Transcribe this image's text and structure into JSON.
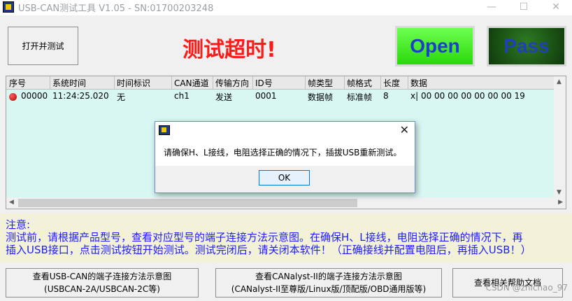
{
  "window": {
    "title": "USB-CAN测试工具 V1.05 - SN:01700203248",
    "minimize": "—",
    "maximize": "☐",
    "close": "✕"
  },
  "toolbar": {
    "start_label": "打开并测试",
    "timeout_text": "测试超时!",
    "open_label": "Open",
    "pass_label": "Pass"
  },
  "grid": {
    "columns": [
      "序号",
      "系统时间",
      "时间标识",
      "CAN通道",
      "传输方向",
      "ID号",
      "帧类型",
      "帧格式",
      "长度",
      "数据"
    ],
    "rows": [
      {
        "index": "00000",
        "time": "11:24:25.020",
        "timestamp": "无",
        "channel": "ch1",
        "direction": "发送",
        "id": "0001",
        "frame_type": "数据帧",
        "frame_format": "标准帧",
        "length": "8",
        "data": "x| 00 00 00 00 00 00 00 19"
      }
    ]
  },
  "notes": {
    "heading": "注意:",
    "line1": "测试前，请根据产品型号，查看对应型号的端子连接方法示意图。在确保H、L接线，电阻选择正确的情况下，再",
    "line2": "插入USB接口，点击测试按钮开始测试。测试完闭后，请关闭本软件！（正确接线并配置电阻后，再插入USB！）"
  },
  "bottom_buttons": {
    "usbcan_line1": "查看USB-CAN的端子连接方法示意图",
    "usbcan_line2": "(USBCAN-2A/USBCAN-2C等)",
    "canalyst_line1": "查看CANalyst-II的端子连接方法示意图",
    "canalyst_line2": "(CANalyst-II至尊版/Linux版/顶配版/OBD通用版等)",
    "help_label": "查看相关帮助文档"
  },
  "dialog": {
    "message": "请确保H、L接线，电阻选择正确的情况下，插拔USB重新测试。",
    "ok_label": "OK",
    "close": "✕"
  },
  "watermark": "CSDN @zhichao_97"
}
